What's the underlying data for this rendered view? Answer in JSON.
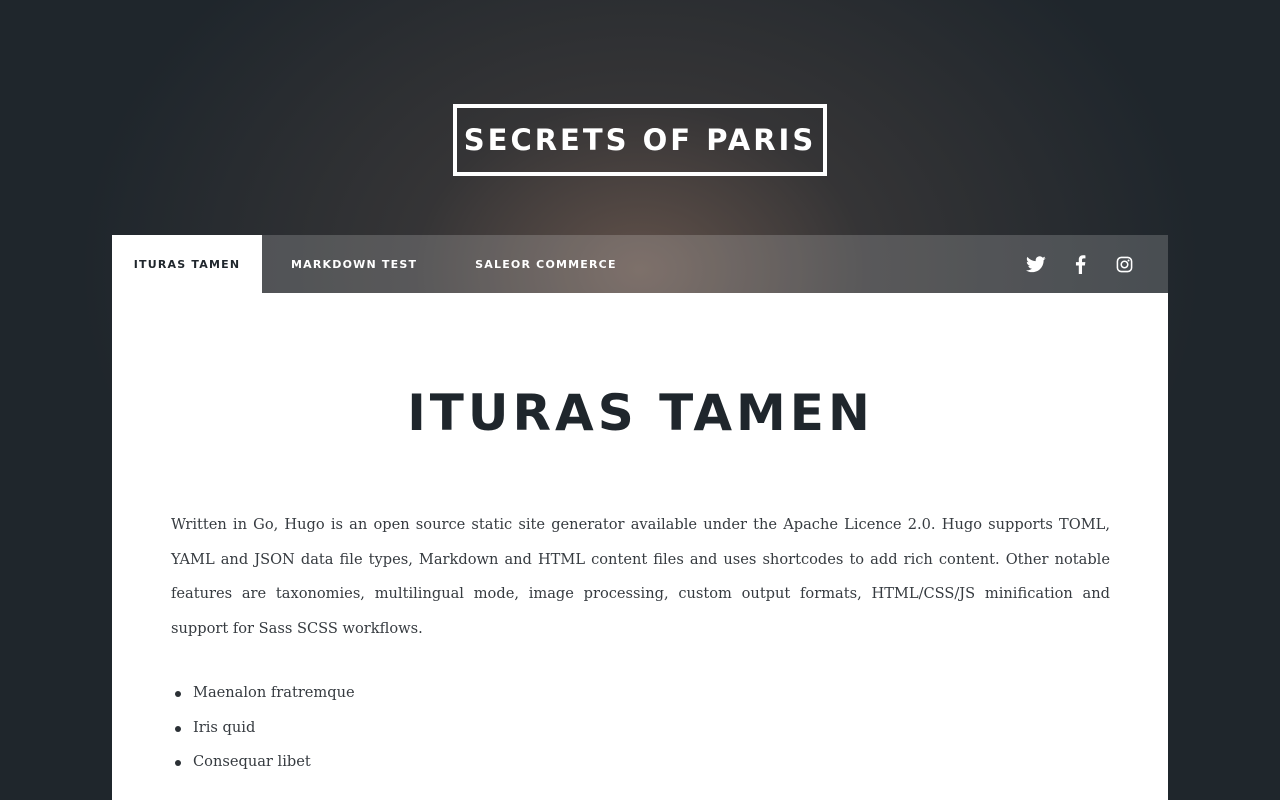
{
  "site": {
    "title": "SECRETS OF PARIS"
  },
  "nav": {
    "tabs": [
      {
        "label": "ITURAS TAMEN",
        "active": true
      },
      {
        "label": "MARKDOWN TEST",
        "active": false
      },
      {
        "label": "SALEOR COMMERCE",
        "active": false
      }
    ],
    "social": [
      {
        "icon": "twitter-icon"
      },
      {
        "icon": "facebook-icon"
      },
      {
        "icon": "instagram-icon"
      }
    ]
  },
  "article": {
    "title": "ITURAS TAMEN",
    "body": "Written in Go, Hugo is an open source static site generator available under the Apache Licence 2.0. Hugo supports TOML, YAML and JSON data file types, Markdown and HTML content files and uses shortcodes to add rich content. Other notable features are taxonomies, multilingual mode, image processing, custom output formats, HTML/CSS/JS minification and support for Sass SCSS workflows.",
    "list": [
      "Maenalon fratremque",
      "Iris quid",
      "Consequar libet"
    ]
  },
  "colors": {
    "background": "#1f262c",
    "text_dark": "#1f262c",
    "body_text": "#363b40",
    "white": "#ffffff"
  }
}
